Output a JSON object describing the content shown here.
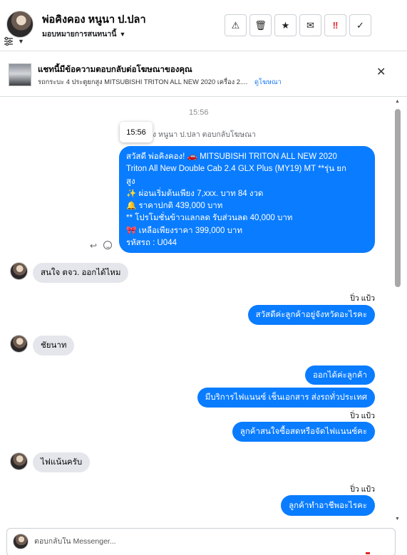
{
  "header": {
    "contact_name": "พ่อคิงคอง หนูนา ป.ปลา",
    "assign_label": "มอบหมายการสนทนานี้",
    "toolbar": {
      "alert": "⚠",
      "delete": "🗑",
      "star": "★",
      "mail": "✉",
      "spam": "‼",
      "done": "✓"
    }
  },
  "ad_banner": {
    "title": "แชทนี้มีข้อความตอบกลับต่อโฆษณาของคุณ",
    "subtitle": "รถกระบะ 4 ประตูยกสูง MITSUBISHI TRITON ALL NEW 2020 เครื่อง 2....",
    "link": "ดูโฆษณา",
    "close": "✕"
  },
  "chat": {
    "time_divider": "15:56",
    "tooltip_time": "15:56",
    "replied_note": "ง หนูนา ป.ปลา ตอบกลับโฆษณา",
    "ad_message_lines": [
      "สวัสดี พ่อคิงคอง! 🚗 MITSUBISHI TRITON ALL NEW 2020",
      "Triton All New Double Cab 2.4 GLX Plus (MY19) MT **รุ่น ยก",
      "สูง",
      "✨ ผ่อนเริ่มต้นเพียง 7,xxx. บาท 84 งวด",
      "🔔 ราคาปกติ 439,000 บาท",
      "** โปรโมชั่นข้าวแลกลด รับส่วนลด 40,000 บาท",
      "🎀 เหลือเพียงราคา 399,000 บาท",
      " รหัสรถ : U044"
    ],
    "messages": {
      "in_1": "สนใจ ตจว. ออกได้ไหม",
      "sender_1": "ปิ่ว แป้ว",
      "out_1": "สวัสดีค่ะลูกค้าอยู่จังหวัดอะไรคะ",
      "in_2": "ชัยนาท",
      "out_2": "ออกได้ค่ะลูกค้า",
      "out_3": "มีบริการไฟแนนซ์ เช็นเอกสาร ส่งรถทั่วประเทศ",
      "sender_2": "ปิ่ว แป้ว",
      "out_4": "ลูกค้าสนใจซื้อสดหรือจัดไฟแนนซ์คะ",
      "in_3": "ไฟแน้นครับ",
      "sender_3": "ปิ่ว แป้ว",
      "out_5": "ลูกค้าทำอาชีพอะไรคะ"
    }
  },
  "composer": {
    "placeholder": "ตอบกลับใน Messenger..."
  }
}
